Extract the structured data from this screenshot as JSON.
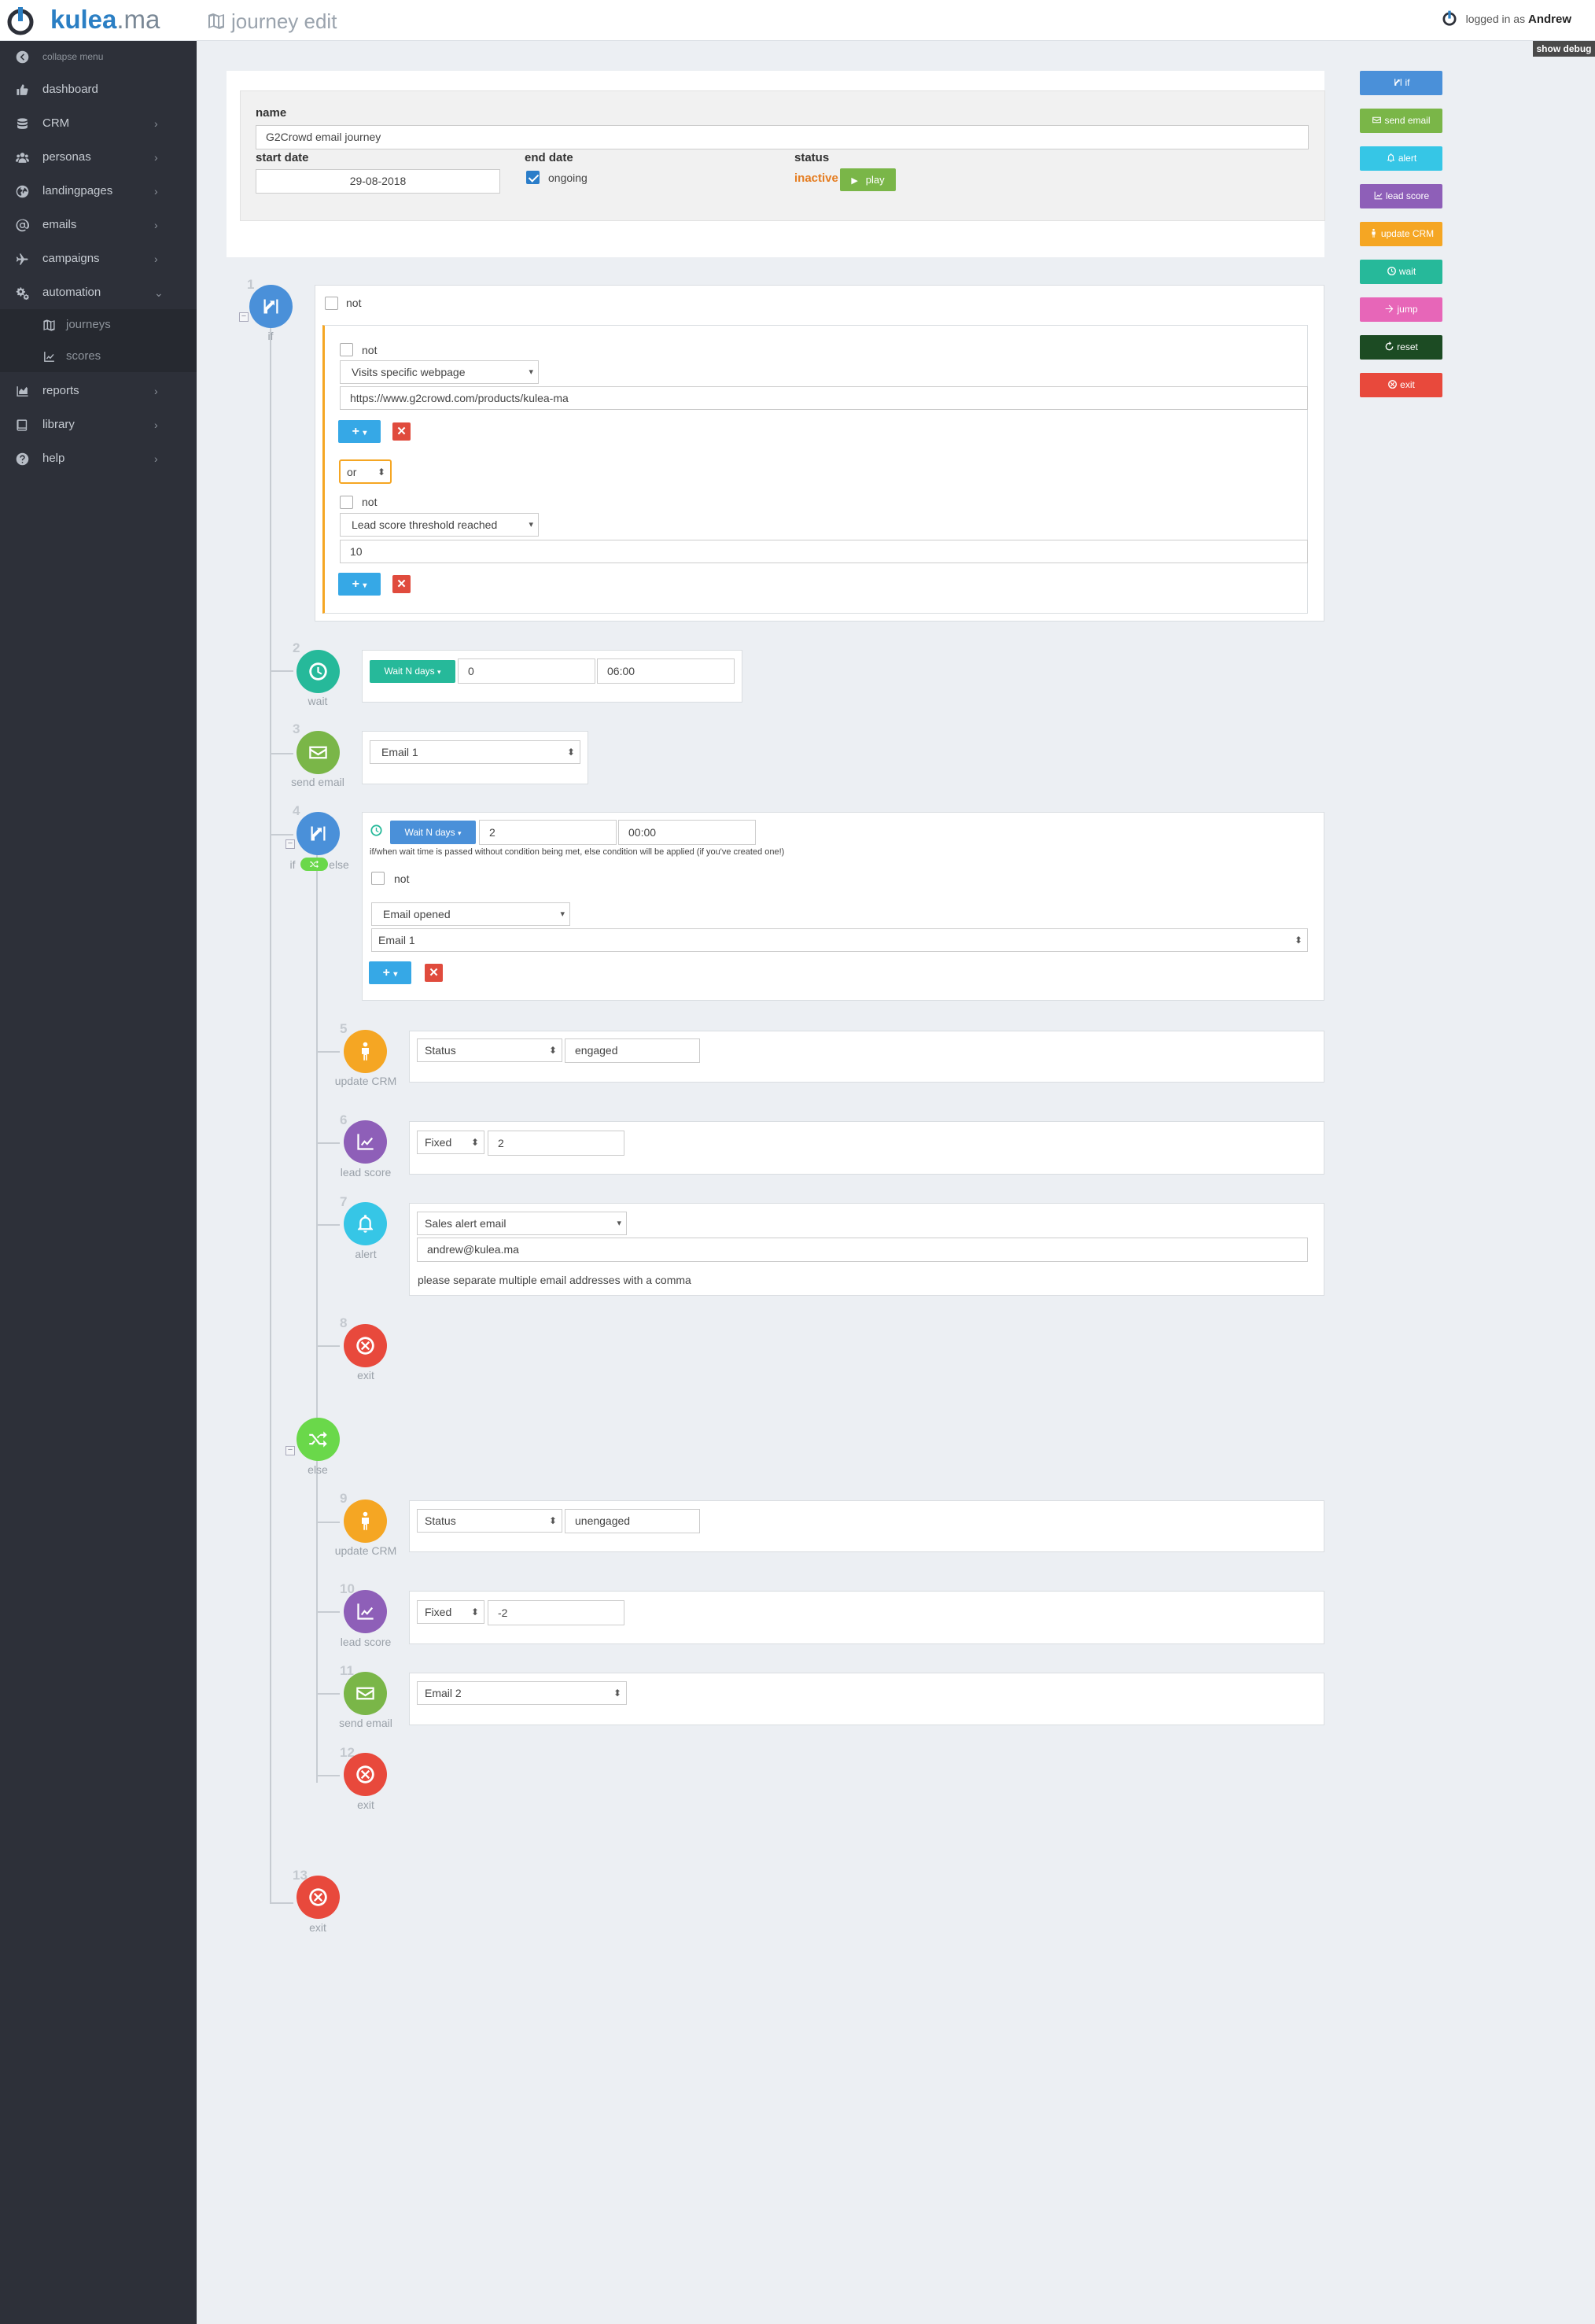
{
  "header": {
    "logo_main": "kulea",
    "logo_suffix": ".ma",
    "page_title": "journey edit",
    "logged_in_prefix": "logged in as",
    "user_name": "Andrew",
    "debug_label": "show debug"
  },
  "sidebar": {
    "collapse_label": "collapse menu",
    "items": [
      {
        "label": "dashboard",
        "icon": "thumbs-up-icon"
      },
      {
        "label": "CRM",
        "icon": "database-icon"
      },
      {
        "label": "personas",
        "icon": "users-icon"
      },
      {
        "label": "landingpages",
        "icon": "globe-icon"
      },
      {
        "label": "emails",
        "icon": "at-icon"
      },
      {
        "label": "campaigns",
        "icon": "plane-icon"
      },
      {
        "label": "automation",
        "icon": "cogs-icon"
      },
      {
        "label": "journeys",
        "icon": "map-icon"
      },
      {
        "label": "scores",
        "icon": "chart-line-icon"
      },
      {
        "label": "reports",
        "icon": "area-chart-icon"
      },
      {
        "label": "library",
        "icon": "book-icon"
      },
      {
        "label": "help",
        "icon": "question-icon"
      }
    ]
  },
  "journey_info": {
    "name_label": "name",
    "name_value": "G2Crowd email journey",
    "start_date_label": "start date",
    "start_date_value": "29-08-2018",
    "end_date_label": "end date",
    "ongoing_label": "ongoing",
    "status_label": "status",
    "status_value": "inactive",
    "play_label": "play"
  },
  "palette": {
    "if": "if",
    "send_email": "send email",
    "alert": "alert",
    "lead_score": "lead score",
    "update_crm": "update CRM",
    "wait": "wait",
    "jump": "jump",
    "reset": "reset",
    "exit": "exit"
  },
  "colors": {
    "if": "#4a90d9",
    "wait": "#26b99a",
    "send_email": "#7ab648",
    "update_crm": "#f5a623",
    "lead_score": "#8e5fb8",
    "alert": "#36c6e6",
    "exit": "#e8493c",
    "else": "#6ad84a",
    "jump": "#e766b8",
    "reset": "#1c4b23"
  },
  "steps": {
    "s1": {
      "num": "1",
      "label": "if",
      "not_label": "not",
      "cond1_not": "not",
      "cond1_type": "Visits specific webpage",
      "cond1_value": "https://www.g2crowd.com/products/kulea-ma",
      "operator": "or",
      "cond2_not": "not",
      "cond2_type": "Lead score threshold reached",
      "cond2_value": "10"
    },
    "s2": {
      "num": "2",
      "label": "wait",
      "wait_type": "Wait N days",
      "days": "0",
      "time": "06:00"
    },
    "s3": {
      "num": "3",
      "label": "send email",
      "email": "Email 1"
    },
    "s4": {
      "num": "4",
      "label_if": "if",
      "label_else": "else",
      "wait_type": "Wait N days",
      "days": "2",
      "time": "00:00",
      "note": "if/when wait time is passed without condition being met, else condition will be applied (if you've created one!)",
      "not_label": "not",
      "cond_type": "Email opened",
      "cond_value": "Email 1"
    },
    "s5": {
      "num": "5",
      "label": "update CRM",
      "field": "Status",
      "value": "engaged"
    },
    "s6": {
      "num": "6",
      "label": "lead score",
      "mode": "Fixed",
      "value": "2"
    },
    "s7": {
      "num": "7",
      "label": "alert",
      "alert_type": "Sales alert email",
      "email": "andrew@kulea.ma",
      "hint": "please separate multiple email addresses with a comma"
    },
    "s8": {
      "num": "8",
      "label": "exit"
    },
    "else": {
      "label": "else"
    },
    "s9": {
      "num": "9",
      "label": "update CRM",
      "field": "Status",
      "value": "unengaged"
    },
    "s10": {
      "num": "10",
      "label": "lead score",
      "mode": "Fixed",
      "value": "-2"
    },
    "s11": {
      "num": "11",
      "label": "send email",
      "email": "Email 2"
    },
    "s12": {
      "num": "12",
      "label": "exit"
    },
    "s13": {
      "num": "13",
      "label": "exit"
    }
  }
}
